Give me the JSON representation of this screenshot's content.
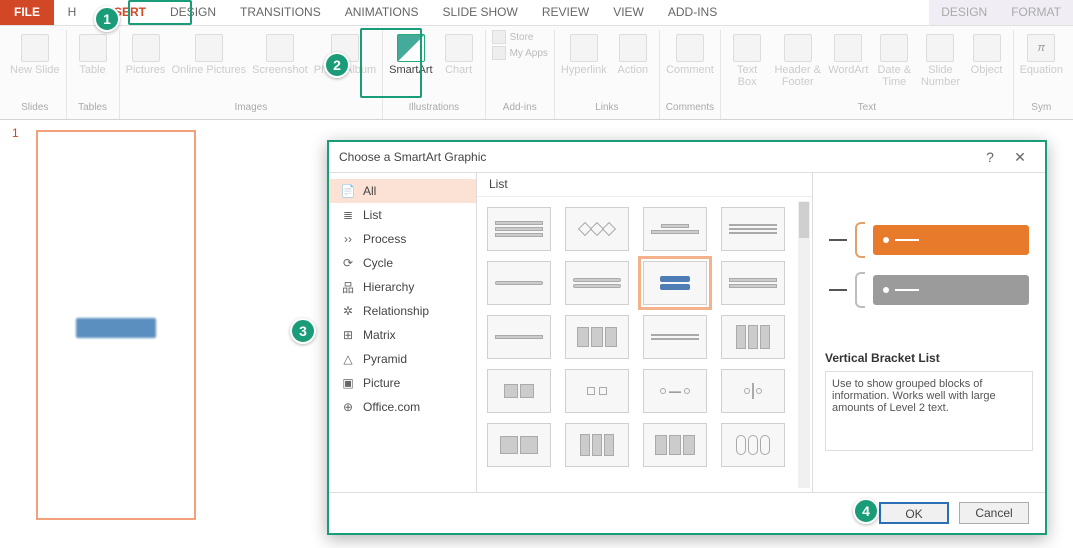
{
  "tabs": {
    "file": "FILE",
    "home": "H",
    "insert": "INSERT",
    "design": "DESIGN",
    "transitions": "TRANSITIONS",
    "animations": "ANIMATIONS",
    "slideshow": "SLIDE SHOW",
    "review": "REVIEW",
    "view": "VIEW",
    "addins": "ADD-INS",
    "ctx_design": "DESIGN",
    "ctx_format": "FORMAT"
  },
  "ribbon": {
    "groups": {
      "slides": "Slides",
      "tables": "Tables",
      "images": "Images",
      "illustrations": "Illustrations",
      "addins_grp": "Add-ins",
      "links": "Links",
      "comments": "Comments",
      "text": "Text",
      "sym": "Sym"
    },
    "items": {
      "new_slide": "New Slide",
      "table": "Table",
      "pictures": "Pictures",
      "online_pictures": "Online Pictures",
      "screenshot": "Screenshot",
      "photo_album": "Photo Album",
      "smartart": "SmartArt",
      "chart": "Chart",
      "store": "Store",
      "myapps": "My Apps",
      "hyperlink": "Hyperlink",
      "action": "Action",
      "comment": "Comment",
      "text_box": "Text Box",
      "header_footer": "Header & Footer",
      "wordart": "WordArt",
      "date_time": "Date & Time",
      "slide_number": "Slide Number",
      "object": "Object",
      "equation": "Equation"
    }
  },
  "slide": {
    "number": "1"
  },
  "dialog": {
    "title": "Choose a SmartArt Graphic",
    "help": "?",
    "close": "✕",
    "categories": {
      "all": "All",
      "list": "List",
      "process": "Process",
      "cycle": "Cycle",
      "hierarchy": "Hierarchy",
      "relationship": "Relationship",
      "matrix": "Matrix",
      "pyramid": "Pyramid",
      "picture": "Picture",
      "office": "Office.com"
    },
    "gallery_header": "List",
    "preview": {
      "title": "Vertical Bracket List",
      "desc": "Use to show grouped blocks of information.  Works well with large amounts of Level 2 text.",
      "colors": {
        "accent1": "#e87a2c",
        "accent2": "#9b9b9b",
        "bracket": "#e2a06a"
      }
    },
    "buttons": {
      "ok": "OK",
      "cancel": "Cancel"
    }
  },
  "callouts": {
    "b1": "1",
    "b2": "2",
    "b3": "3",
    "b4": "4"
  }
}
